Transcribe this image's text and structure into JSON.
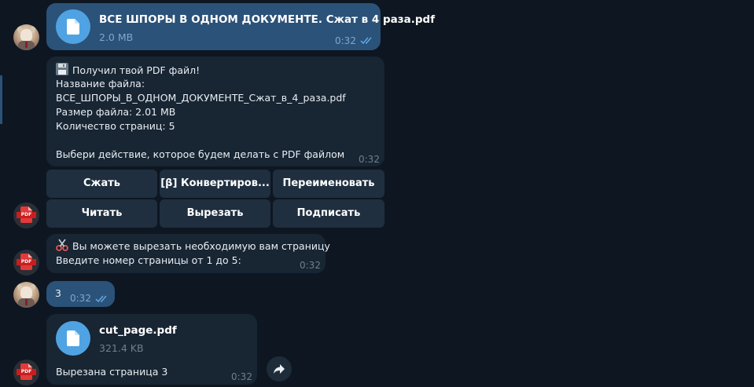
{
  "messages": {
    "file_out": {
      "name": "ВСЕ ШПОРЫ В ОДНОМ ДОКУМЕНТЕ. Сжат в 4 раза.pdf",
      "size": "2.0 MB",
      "time": "0:32"
    },
    "bot_info": {
      "line1": "Получил твой PDF файл!",
      "line2": "Название файла:",
      "line3": "ВСЕ_ШПОРЫ_В_ОДНОМ_ДОКУМЕНТЕ_Сжат_в_4_раза.pdf",
      "line4": "Размер файла: 2.01 MB",
      "line5": "Количество страниц: 5",
      "line6": "Выбери действие, которое будем делать с PDF файлом",
      "time": "0:32",
      "emoji_icon": "floppy-disk-icon"
    },
    "keyboard": {
      "row1": [
        "Сжать",
        "[β] Конвертиров...",
        "Переименовать"
      ],
      "row2": [
        "Читать",
        "Вырезать",
        "Подписать"
      ]
    },
    "bot_cut": {
      "line1": "Вы можете вырезать необходимую вам страницу",
      "line2": "Введите номер страницы от 1 до 5:",
      "time": "0:32",
      "emoji_icon": "scissors-icon"
    },
    "user_reply": {
      "text": "3",
      "time": "0:32"
    },
    "file_in": {
      "name": "cut_page.pdf",
      "size": "321.4 KB",
      "caption": "Вырезана страница 3",
      "time": "0:32"
    }
  },
  "colors": {
    "background": "#0e1621",
    "outgoing_bubble": "#2b5278",
    "incoming_bubble": "#182533",
    "keyboard_button": "#1f2f3f",
    "file_icon": "#4fa3e3",
    "read_ticks": "#5fa8e8"
  }
}
